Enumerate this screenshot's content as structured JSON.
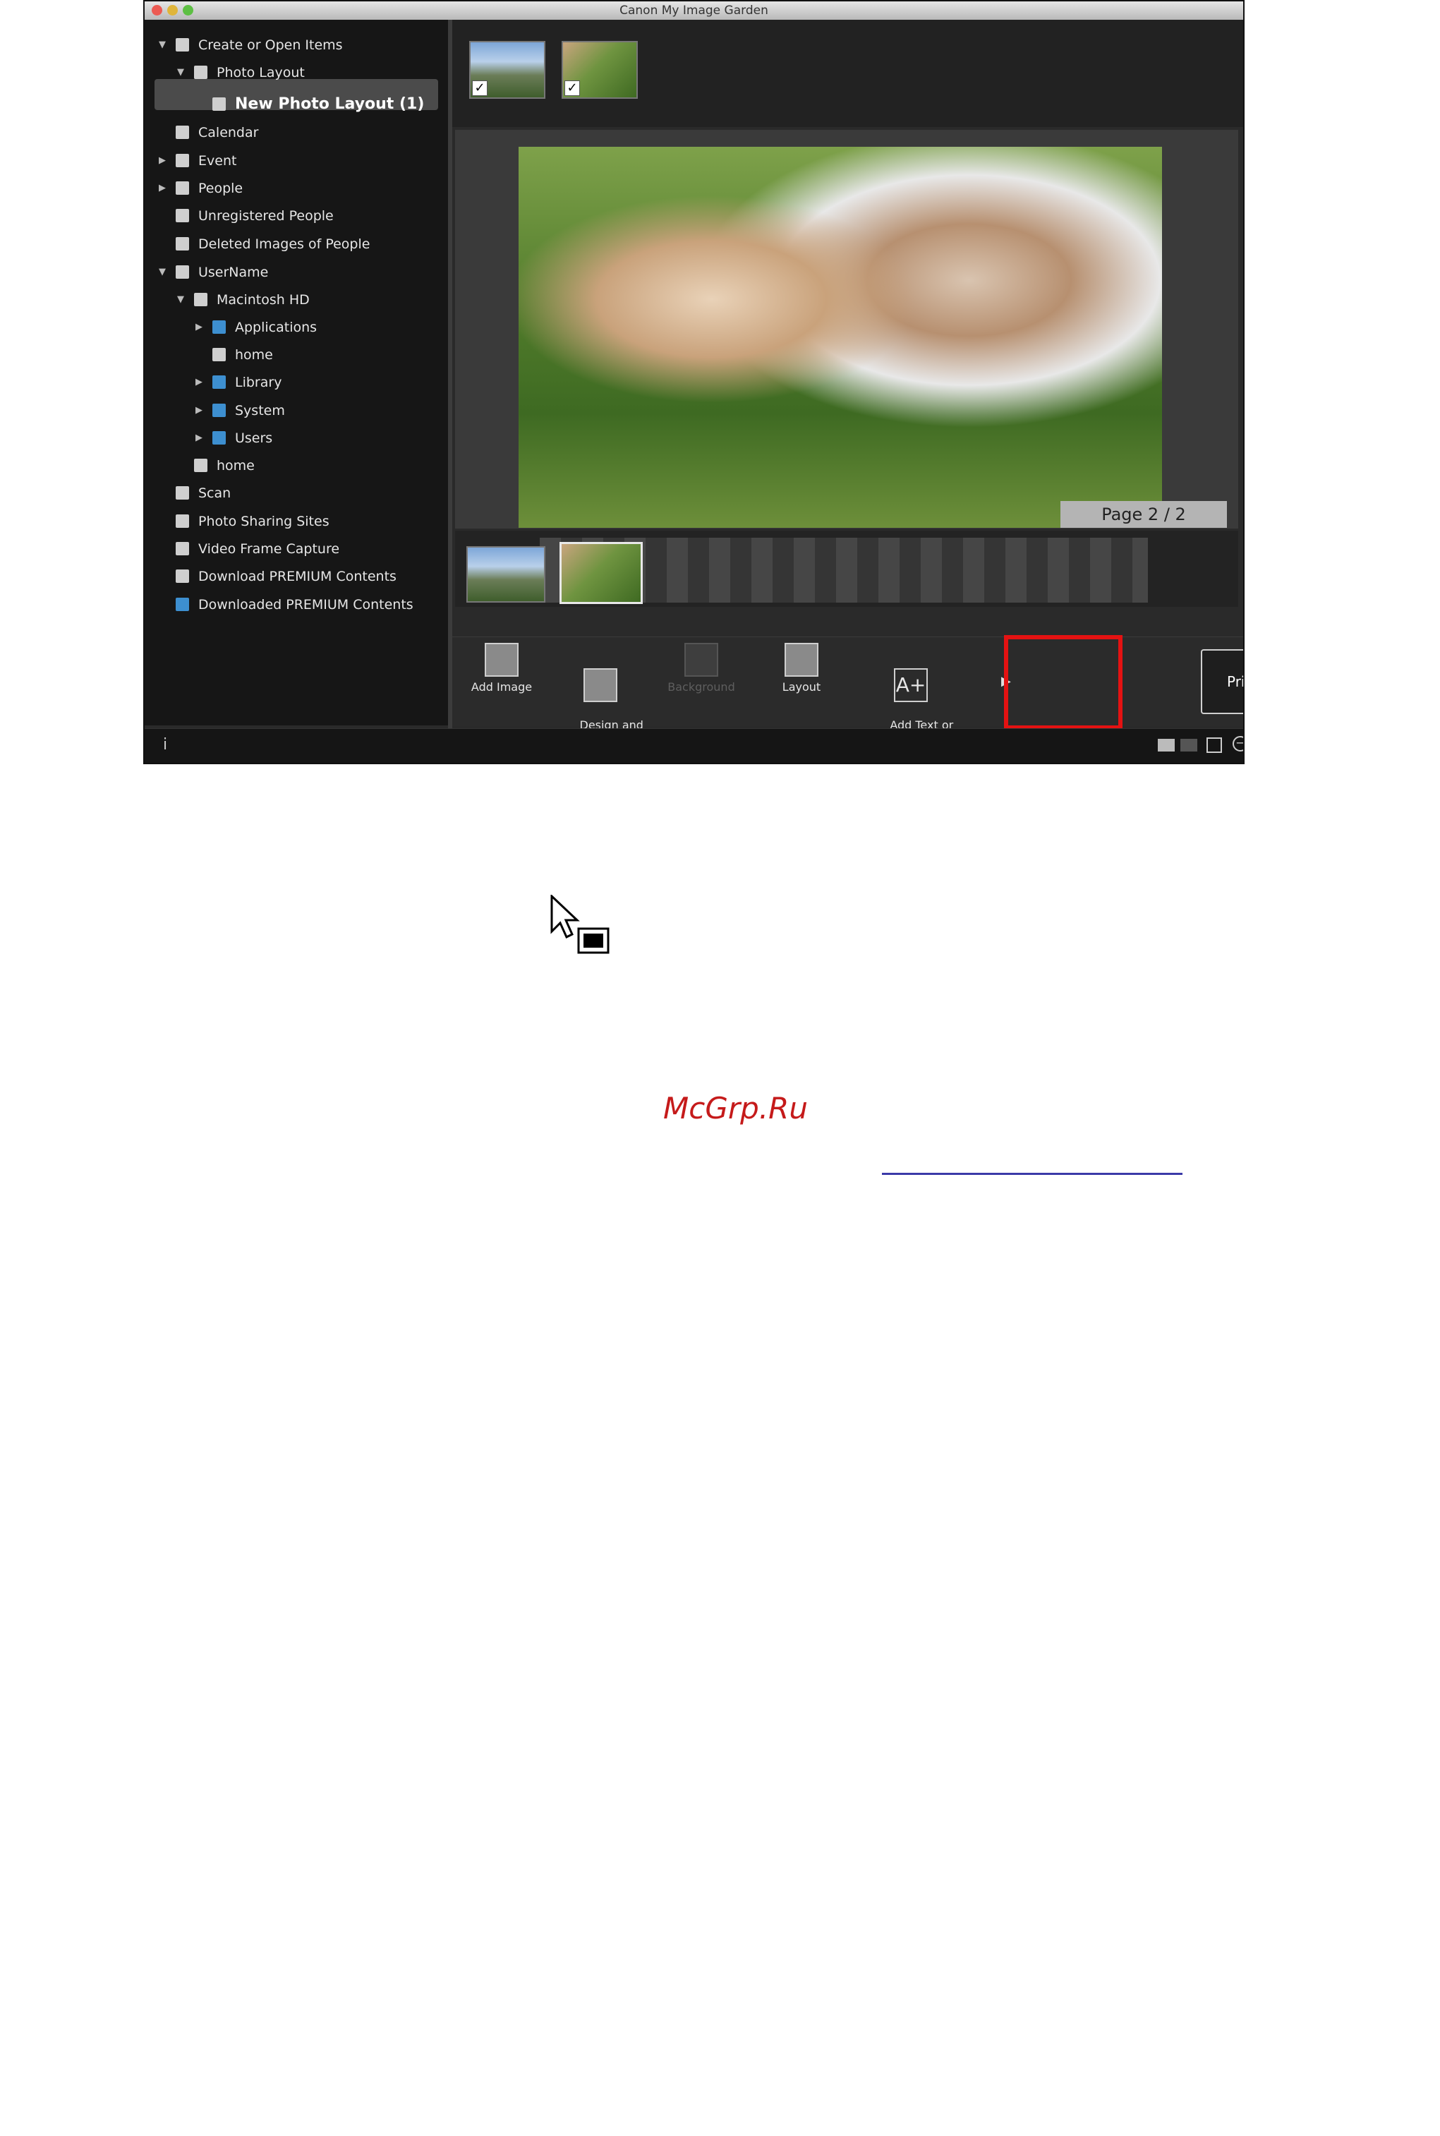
{
  "window": {
    "title": "Canon My Image Garden"
  },
  "sidebar": {
    "items": [
      {
        "label": "Create or Open Items",
        "arrow": "▼",
        "icon": "create-icon"
      },
      {
        "label": "Photo Layout",
        "arrow": "▼",
        "icon": "layout-icon"
      },
      {
        "label": "New Photo Layout (1)",
        "arrow": "",
        "icon": "layout-icon",
        "selected": true
      },
      {
        "label": "Calendar",
        "arrow": "",
        "icon": "calendar-icon"
      },
      {
        "label": "Event",
        "arrow": "▶",
        "icon": "event-icon"
      },
      {
        "label": "People",
        "arrow": "▶",
        "icon": "person-icon"
      },
      {
        "label": "Unregistered People",
        "arrow": "",
        "icon": "person-unknown-icon"
      },
      {
        "label": "Deleted Images of People",
        "arrow": "",
        "icon": "person-deleted-icon"
      },
      {
        "label": "UserName",
        "arrow": "▼",
        "icon": "computer-icon"
      },
      {
        "label": "Macintosh HD",
        "arrow": "▼",
        "icon": "drive-icon"
      },
      {
        "label": "Applications",
        "arrow": "▶",
        "icon": "folder-icon"
      },
      {
        "label": "home",
        "arrow": "",
        "icon": "home-icon"
      },
      {
        "label": "Library",
        "arrow": "▶",
        "icon": "folder-icon"
      },
      {
        "label": "System",
        "arrow": "▶",
        "icon": "folder-icon"
      },
      {
        "label": "Users",
        "arrow": "▶",
        "icon": "folder-icon"
      },
      {
        "label": "home",
        "arrow": "",
        "icon": "home-icon"
      },
      {
        "label": "Scan",
        "arrow": "",
        "icon": "scan-icon"
      },
      {
        "label": "Photo Sharing Sites",
        "arrow": "",
        "icon": "share-icon"
      },
      {
        "label": "Video Frame Capture",
        "arrow": "",
        "icon": "film-icon"
      },
      {
        "label": "Download PREMIUM Contents",
        "arrow": "",
        "icon": "download-icon"
      },
      {
        "label": "Downloaded PREMIUM Contents",
        "arrow": "",
        "icon": "folder-icon"
      }
    ]
  },
  "preview": {
    "page_label": "Page 2 / 2"
  },
  "toolbar": {
    "add_image": "Add Image",
    "design_paper": "Design and\nPaper",
    "background": "Background",
    "layout": "Layout",
    "add_text": "Add Text or\nLayout Frame",
    "print": "Print",
    "back_glyph": "◀",
    "forward_glyph": "▶",
    "more_glyph": "▶"
  },
  "status": {
    "info_glyph": "i"
  },
  "footer": {
    "watermark": "McGrp.Ru"
  },
  "colors": {
    "highlight": "#e41212",
    "watermark": "#c51a1a",
    "link_underline": "#3b3aa8"
  }
}
